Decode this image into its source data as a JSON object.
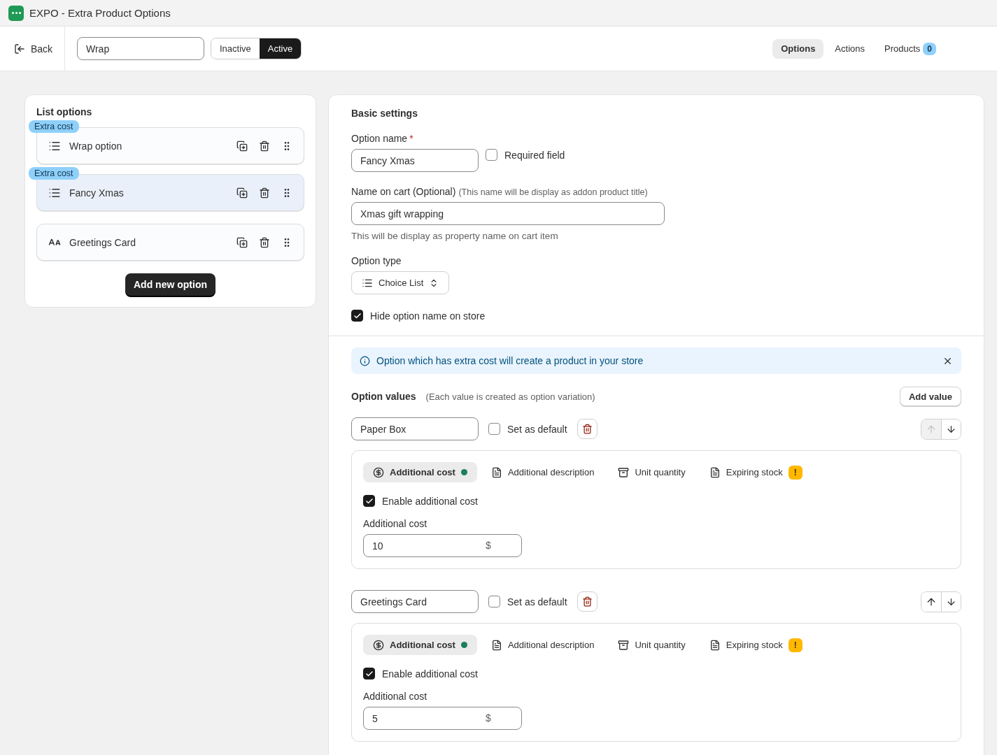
{
  "app_title": "EXPO - Extra Product Options",
  "toolbar": {
    "back_label": "Back",
    "name_value": "Wrap",
    "status": [
      {
        "label": "Inactive",
        "selected": false
      },
      {
        "label": "Active",
        "selected": true
      }
    ],
    "tabs": [
      {
        "label": "Options",
        "selected": true
      },
      {
        "label": "Actions",
        "selected": false
      },
      {
        "label": "Products",
        "selected": false,
        "count": "0"
      }
    ]
  },
  "list_options": {
    "title": "List options",
    "items": [
      {
        "label": "Wrap option",
        "kind": "list",
        "badge": "Extra cost",
        "selected": false
      },
      {
        "label": "Fancy Xmas",
        "kind": "list",
        "badge": "Extra cost",
        "selected": true
      },
      {
        "label": "Greetings Card",
        "kind": "text",
        "selected": false
      }
    ],
    "add_button": "Add new option"
  },
  "basic_settings": {
    "title": "Basic settings",
    "option_name": {
      "label": "Option name",
      "required_mark": "*",
      "value": "Fancy Xmas"
    },
    "required_field": {
      "label": "Required field",
      "checked": false
    },
    "name_on_cart": {
      "label": "Name on cart (Optional)",
      "hint": "(This name will be display as addon product title)",
      "value": "Xmas gift wrapping",
      "help": "This will be display as property name on cart item"
    },
    "option_type": {
      "label": "Option type",
      "value": "Choice List"
    },
    "hide_name": {
      "label": "Hide option name on store",
      "checked": true
    }
  },
  "info_banner": {
    "text": "Option which has extra cost will create a product in your store"
  },
  "option_values": {
    "title": "Option values",
    "note": "(Each value is created as option variation)",
    "add_button": "Add value",
    "values": [
      {
        "name": "Paper Box",
        "default": {
          "label": "Set as default",
          "checked": false
        },
        "up_disabled": true,
        "down_disabled": false,
        "subtabs": [
          {
            "label": "Additional cost",
            "kind": "cost",
            "selected": true,
            "dot": true
          },
          {
            "label": "Additional description",
            "kind": "description",
            "selected": false
          },
          {
            "label": "Unit quantity",
            "kind": "unit",
            "selected": false
          },
          {
            "label": "Expiring stock",
            "kind": "description",
            "selected": false,
            "warning": "!"
          }
        ],
        "enable": {
          "label": "Enable additional cost",
          "checked": true
        },
        "cost_label": "Additional cost",
        "cost_value": "10",
        "currency": "$"
      },
      {
        "name": "Greetings Card",
        "default": {
          "label": "Set as default",
          "checked": false
        },
        "up_disabled": false,
        "down_disabled": false,
        "subtabs": [
          {
            "label": "Additional cost",
            "kind": "cost",
            "selected": true,
            "dot": true
          },
          {
            "label": "Additional description",
            "kind": "description",
            "selected": false
          },
          {
            "label": "Unit quantity",
            "kind": "unit",
            "selected": false
          },
          {
            "label": "Expiring stock",
            "kind": "description",
            "selected": false,
            "warning": "!"
          }
        ],
        "enable": {
          "label": "Enable additional cost",
          "checked": true
        },
        "cost_label": "Additional cost",
        "cost_value": "5",
        "currency": "$"
      }
    ]
  }
}
